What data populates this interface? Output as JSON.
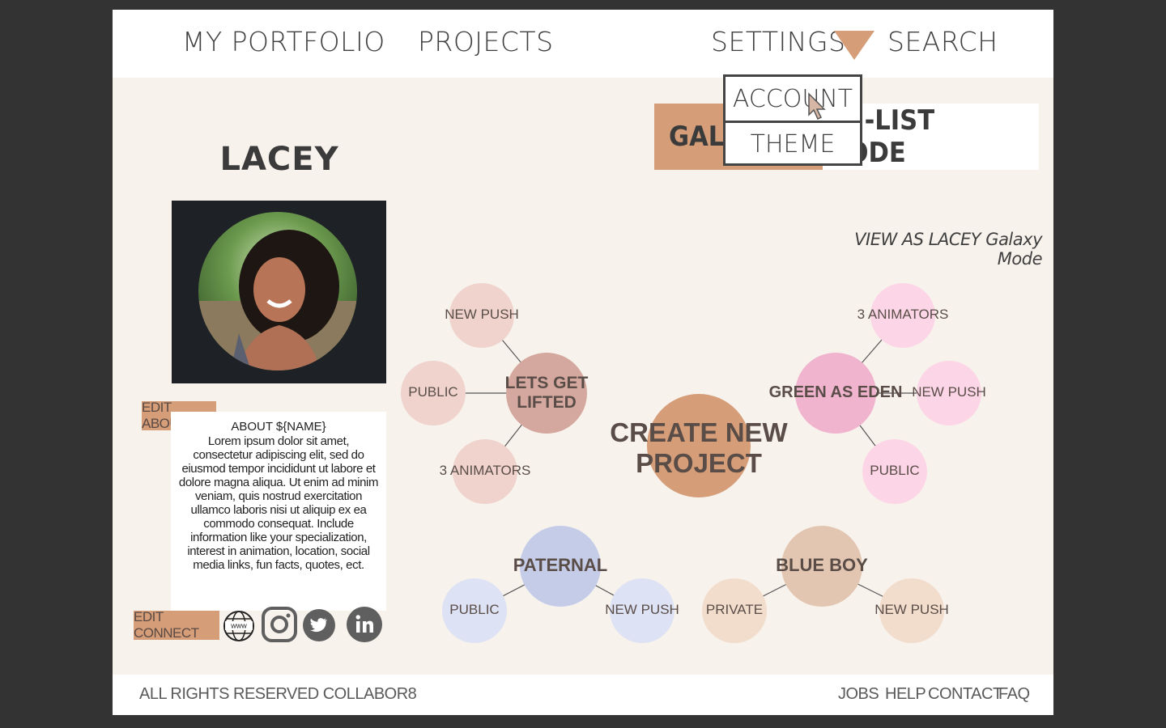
{
  "nav": {
    "portfolio": "MY PORTFOLIO",
    "projects": "PROJECTS",
    "settings": "SETTINGS",
    "search": "SEARCH"
  },
  "dropdown": {
    "account": "ACCOUNT",
    "theme": "THEME"
  },
  "modes": {
    "galaxy": "GALA",
    "list": "ON-LIST MODE"
  },
  "profile": {
    "name": "LACEY",
    "edit_about": "EDIT ABOUT",
    "about_title": "ABOUT ${NAME}",
    "about_body": "Lorem ipsum dolor sit amet, consectetur adipiscing elit, sed do eiusmod tempor incididunt ut labore et dolore magna aliqua. Ut enim ad minim veniam, quis nostrud exercitation ullamco laboris nisi ut aliquip ex ea commodo consequat. Include information like your specialization, interest in animation, location, social media links, fun facts, quotes, ect.",
    "edit_connect": "EDIT CONNECT",
    "website_label": "www"
  },
  "view_as": "VIEW AS LACEY Galaxy Mode",
  "galaxy": {
    "center": "CREATE NEW PROJECT",
    "projects": [
      {
        "title": "LETS GET LIFTED",
        "color": "#d4a89e",
        "sat_color": "#efd3cc",
        "satellites": [
          "NEW PUSH",
          "PUBLIC",
          "3 ANIMATORS"
        ]
      },
      {
        "title": "GREEN AS EDEN",
        "color": "#f0b4cf",
        "sat_color": "#fcd6e7",
        "satellites": [
          "3 ANIMATORS",
          "NEW PUSH",
          "PUBLIC"
        ]
      },
      {
        "title": "PATERNAL",
        "color": "#c4cce8",
        "sat_color": "#dde2f5",
        "satellites": [
          "PUBLIC",
          "NEW PUSH"
        ]
      },
      {
        "title": "BLUE BOY",
        "color": "#e3c6b1",
        "sat_color": "#f2dccb",
        "satellites": [
          "PRIVATE",
          "NEW PUSH"
        ]
      }
    ],
    "center_color": "#d59d78"
  },
  "footer": {
    "copyright": "ALL RIGHTS RESERVED COLLABOR8",
    "jobs": "JOBS",
    "help": "HELP",
    "contact": "CONTACT",
    "faq": "FAQ"
  },
  "colors": {
    "accent": "#d59d78",
    "background": "#f8f2ec",
    "outer": "#333333"
  }
}
